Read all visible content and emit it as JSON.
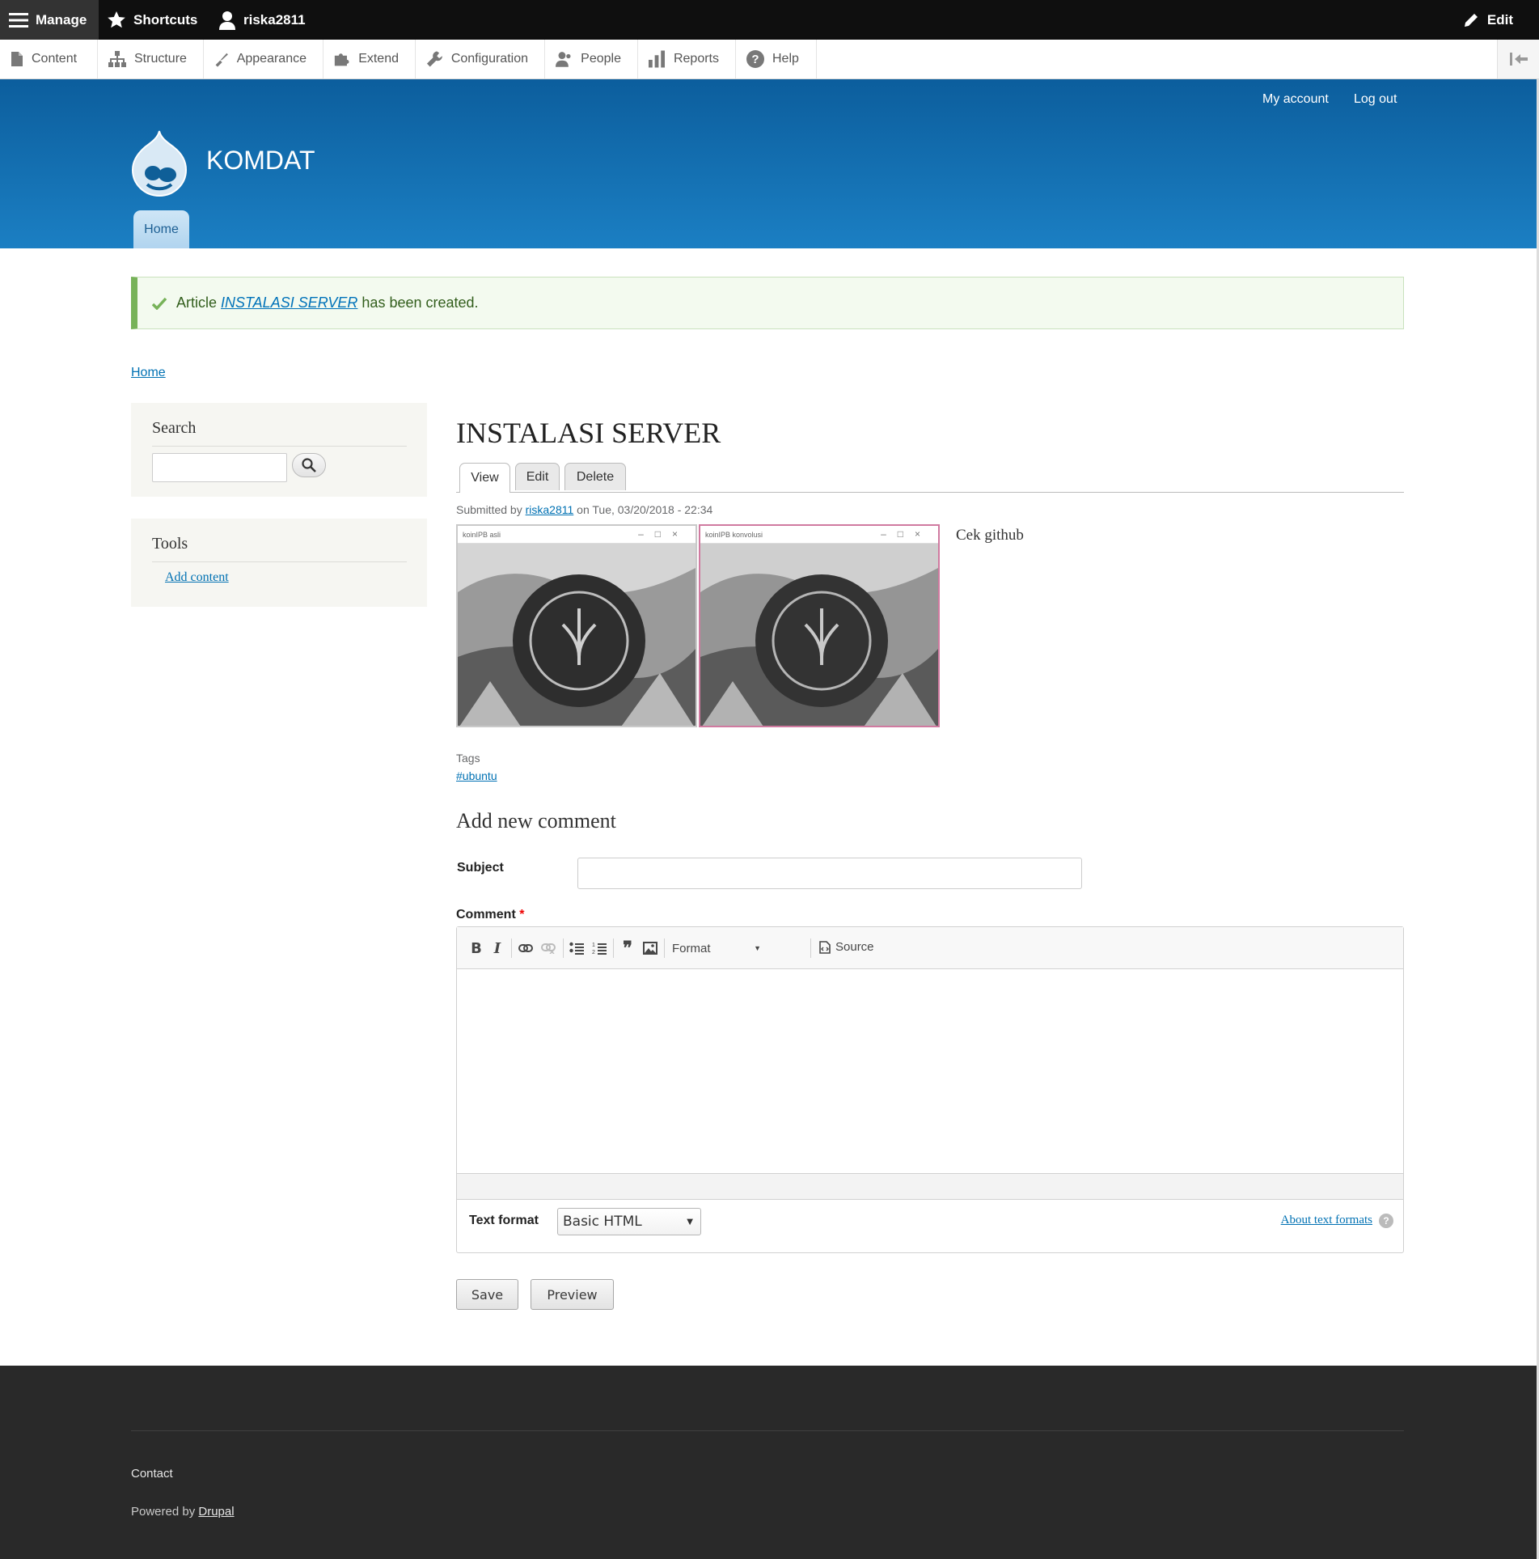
{
  "toolbar": {
    "manage_label": "Manage",
    "shortcuts_label": "Shortcuts",
    "user_label": "riska2811",
    "edit_label": "Edit"
  },
  "tray": {
    "items": [
      {
        "label": "Content",
        "icon": "file-icon"
      },
      {
        "label": "Structure",
        "icon": "sitemap-icon"
      },
      {
        "label": "Appearance",
        "icon": "brush-icon"
      },
      {
        "label": "Extend",
        "icon": "puzzle-icon"
      },
      {
        "label": "Configuration",
        "icon": "wrench-icon"
      },
      {
        "label": "People",
        "icon": "people-icon"
      },
      {
        "label": "Reports",
        "icon": "bar-chart-icon"
      },
      {
        "label": "Help",
        "icon": "help-icon"
      }
    ]
  },
  "header": {
    "my_account": "My account",
    "log_out": "Log out",
    "site_name": "KOMDAT",
    "primary_home": "Home",
    "colors": {
      "top": "#0c5e9d",
      "bottom": "#1b7fc3"
    }
  },
  "status": {
    "prefix": "Article",
    "link": "INSTALASI SERVER",
    "suffix": "has been created.",
    "color": "#77b259"
  },
  "breadcrumb": {
    "home": "Home"
  },
  "sidebar": {
    "search_title": "Search",
    "search_value": "",
    "tools_title": "Tools",
    "add_content": "Add content"
  },
  "article": {
    "title": "INSTALASI SERVER",
    "tabs": {
      "view": "View",
      "edit": "Edit",
      "delete": "Delete"
    },
    "submitted_prefix": "Submitted by",
    "author": "riska2811",
    "submitted_on": "on Tue, 03/20/2018 - 22:34",
    "images": [
      {
        "window_title": "koinIPB asli"
      },
      {
        "window_title": "koinIPB konvolusi"
      }
    ],
    "body": "Cek github",
    "tags_label": "Tags",
    "tag": "#ubuntu"
  },
  "comment_form": {
    "heading": "Add new comment",
    "subject_label": "Subject",
    "subject_value": "",
    "comment_label": "Comment",
    "required_mark": "*",
    "editor_buttons": [
      "bold-icon",
      "italic-icon",
      "link-icon",
      "unlink-icon",
      "bulleted-list-icon",
      "numbered-list-icon",
      "blockquote-icon",
      "image-icon"
    ],
    "format_label": "Format",
    "source_label": "Source",
    "text_format_label": "Text format",
    "text_format_value": "Basic HTML",
    "about_formats": "About text formats",
    "help_glyph": "?",
    "save": "Save",
    "preview": "Preview"
  },
  "footer": {
    "contact": "Contact",
    "powered_prefix": "Powered by",
    "powered_link": "Drupal"
  }
}
